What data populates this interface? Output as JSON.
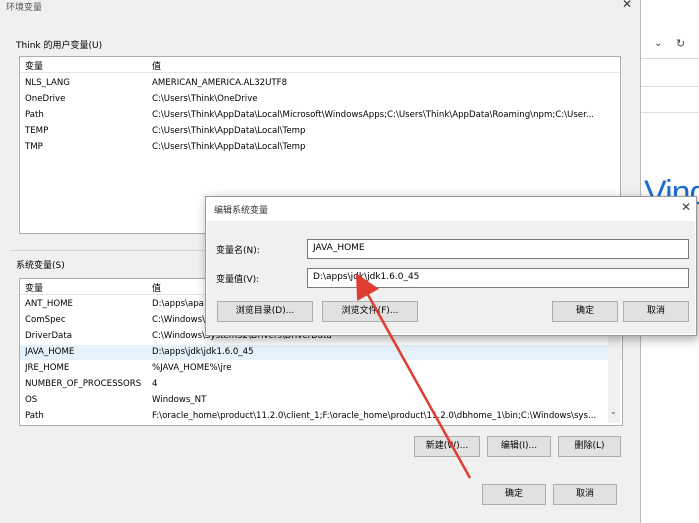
{
  "main_dialog": {
    "title": "环境变量",
    "user_vars_group": "Think 的用户变量(U)",
    "user_vars_columns": [
      "变量",
      "值"
    ],
    "user_vars": [
      {
        "name": "NLS_LANG",
        "value": "AMERICAN_AMERICA.AL32UTF8"
      },
      {
        "name": "OneDrive",
        "value": "C:\\Users\\Think\\OneDrive"
      },
      {
        "name": "Path",
        "value": "C:\\Users\\Think\\AppData\\Local\\Microsoft\\WindowsApps;C:\\Users\\Think\\AppData\\Roaming\\npm;C:\\User..."
      },
      {
        "name": "TEMP",
        "value": "C:\\Users\\Think\\AppData\\Local\\Temp"
      },
      {
        "name": "TMP",
        "value": "C:\\Users\\Think\\AppData\\Local\\Temp"
      }
    ],
    "system_vars_group": "系统变量(S)",
    "system_vars_columns": [
      "变量",
      "值"
    ],
    "system_vars": [
      {
        "name": "ANT_HOME",
        "value": "D:\\apps\\apa"
      },
      {
        "name": "ComSpec",
        "value": "C:\\Windows\\"
      },
      {
        "name": "DriverData",
        "value": "C:\\Windows\\System32\\Drivers\\DriverData"
      },
      {
        "name": "JAVA_HOME",
        "value": "D:\\apps\\jdk\\jdk1.6.0_45"
      },
      {
        "name": "JRE_HOME",
        "value": "%JAVA_HOME%\\jre"
      },
      {
        "name": "NUMBER_OF_PROCESSORS",
        "value": "4"
      },
      {
        "name": "OS",
        "value": "Windows_NT"
      },
      {
        "name": "Path",
        "value": "F:\\oracle_home\\product\\11.2.0\\client_1;F:\\oracle_home\\product\\11.2.0\\dbhome_1\\bin;C:\\Windows\\sys..."
      }
    ],
    "buttons": {
      "new": "新建(W)...",
      "edit": "编辑(I)...",
      "delete": "删除(L)",
      "ok": "确定",
      "cancel": "取消"
    }
  },
  "edit_dialog": {
    "title": "编辑系统变量",
    "name_label": "变量名(N):",
    "name_value": "JAVA_HOME",
    "value_label": "变量值(V):",
    "value_value": "D:\\apps\\jdk\\jdk1.6.0_45",
    "browse_dir": "浏览目录(D)...",
    "browse_file": "浏览文件(F)...",
    "ok": "确定",
    "cancel": "取消"
  },
  "background": {
    "text_fragment": "Vind"
  },
  "colors": {
    "arrow": "#e03c31",
    "selection": "#e5f1fb",
    "accent": "#1f6fcf"
  }
}
